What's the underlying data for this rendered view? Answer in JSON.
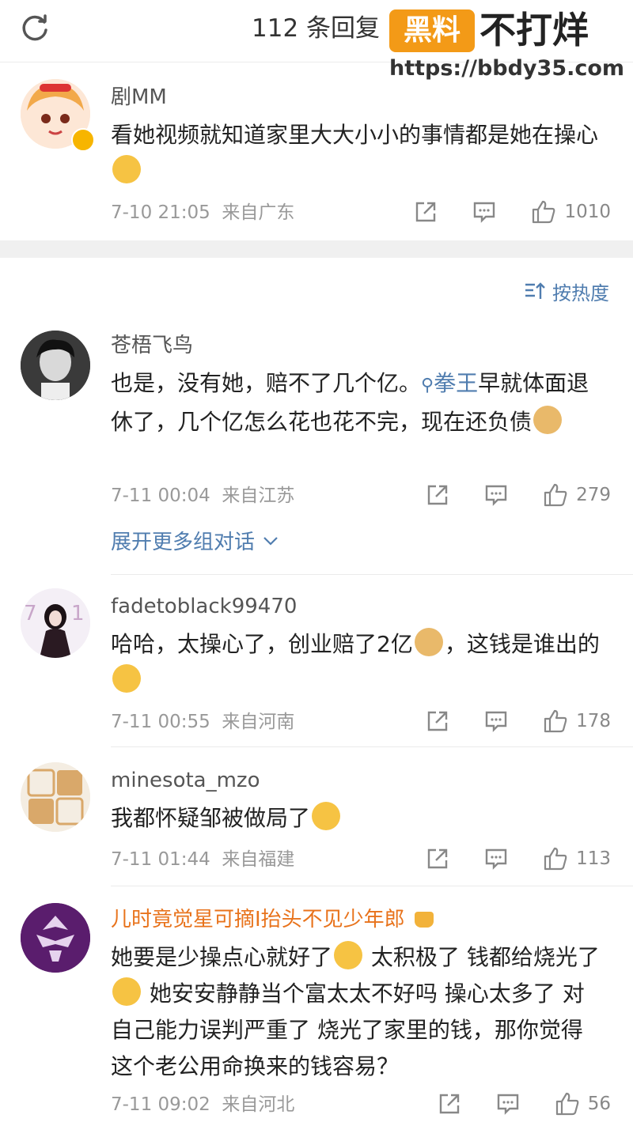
{
  "header": {
    "title": "112 条回复",
    "refresh_icon": "refresh-icon"
  },
  "watermark": {
    "badge": "黑料",
    "text": "不打烊",
    "url": "https://bbdy35.com"
  },
  "main_comment": {
    "name": "剧MM",
    "text": "看她视频就知道家里大大小小的事情都是她在操心",
    "time": "7-10 21:05",
    "location": "来自广东",
    "likes": "1010"
  },
  "sort": {
    "label": "按热度"
  },
  "comments": [
    {
      "name": "苍梧飞鸟",
      "text_before": "也是，没有她，赔不了几个亿。",
      "link": "拳王",
      "text_after": "早就体面退休了，几个亿怎么花也花不完，现在还负债",
      "time": "7-11 00:04",
      "location": "来自江苏",
      "likes": "279"
    },
    {
      "name": "fadetoblack99470",
      "text_part1": "哈哈，太操心了，创业赔了2亿",
      "text_part2": "，这钱是谁出的",
      "time": "7-11 00:55",
      "location": "来自河南",
      "likes": "178"
    },
    {
      "name": "minesota_mzo",
      "text": "我都怀疑邹被做局了",
      "time": "7-11 01:44",
      "location": "来自福建",
      "likes": "113"
    },
    {
      "name": "儿时竟觉星可摘I抬头不见少年郎",
      "text_part1": "她要是少操点心就好了",
      "text_part2": " 太积极了 钱都给烧光了",
      "text_part3": " 她安安静静当个富太太不好吗 操心太多了 对自己能力误判严重了 烧光了家里的钱，那你觉得这个老公用命换来的钱容易？",
      "time": "7-11 09:02",
      "location": "来自河北",
      "likes": "56"
    }
  ],
  "expand_link": "展开更多组对话",
  "colors": {
    "link": "#507daf",
    "orange_name": "#e8731c",
    "badge": "#f7b500"
  }
}
